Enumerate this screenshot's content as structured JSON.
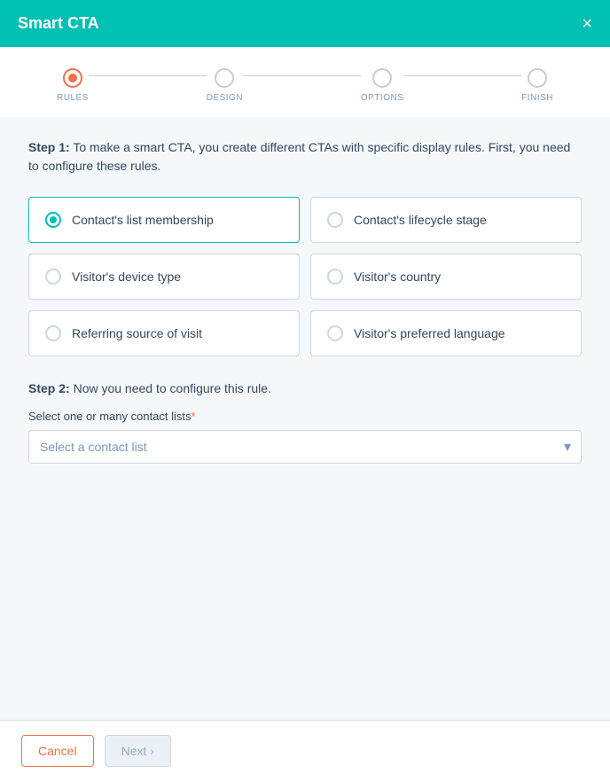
{
  "header": {
    "title": "Smart CTA",
    "close_label": "×"
  },
  "steps": [
    {
      "id": "rules",
      "label": "RULES",
      "active": true
    },
    {
      "id": "design",
      "label": "DESIGN",
      "active": false
    },
    {
      "id": "options",
      "label": "OPTIONS",
      "active": false
    },
    {
      "id": "finish",
      "label": "FINISH",
      "active": false
    }
  ],
  "step1": {
    "description_prefix": "Step 1:",
    "description_body": " To make a smart CTA, you create different CTAs with specific display rules. First, you need to configure these rules."
  },
  "rule_options": [
    {
      "id": "contact-list",
      "label": "Contact's list membership",
      "selected": true
    },
    {
      "id": "lifecycle-stage",
      "label": "Contact's lifecycle stage",
      "selected": false
    },
    {
      "id": "device-type",
      "label": "Visitor's device type",
      "selected": false
    },
    {
      "id": "country",
      "label": "Visitor's country",
      "selected": false
    },
    {
      "id": "referring-source",
      "label": "Referring source of visit",
      "selected": false
    },
    {
      "id": "preferred-language",
      "label": "Visitor's preferred language",
      "selected": false
    }
  ],
  "step2": {
    "label_prefix": "Step 2:",
    "label_body": " Now you need to configure this rule.",
    "field_label": "Select one or many contact lists",
    "required_marker": "*",
    "select_placeholder": "Select a contact list"
  },
  "footer": {
    "cancel_label": "Cancel",
    "next_label": "Next ›"
  }
}
